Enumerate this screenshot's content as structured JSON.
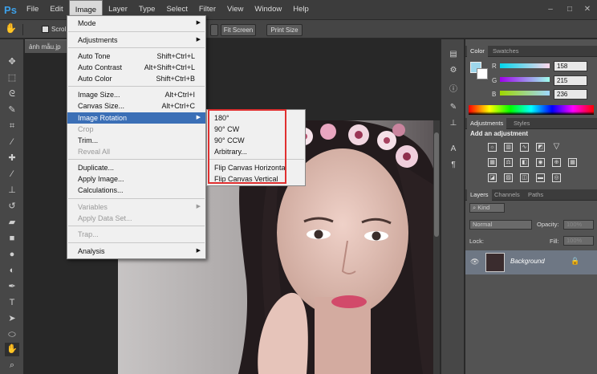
{
  "app": {
    "logo": "Ps"
  },
  "menubar": {
    "items": [
      "File",
      "Edit",
      "Image",
      "Layer",
      "Type",
      "Select",
      "Filter",
      "View",
      "Window",
      "Help"
    ],
    "active": "Image"
  },
  "options": {
    "scroll_label": "Scrol",
    "fit_screen": "Fit Screen",
    "print_size": "Print Size"
  },
  "document": {
    "tab_title": "ảnh mẫu.jp"
  },
  "image_menu": {
    "mode": "Mode",
    "adjustments": "Adjustments",
    "auto_tone": "Auto Tone",
    "auto_tone_sc": "Shift+Ctrl+L",
    "auto_contrast": "Auto Contrast",
    "auto_contrast_sc": "Alt+Shift+Ctrl+L",
    "auto_color": "Auto Color",
    "auto_color_sc": "Shift+Ctrl+B",
    "image_size": "Image Size...",
    "image_size_sc": "Alt+Ctrl+I",
    "canvas_size": "Canvas Size...",
    "canvas_size_sc": "Alt+Ctrl+C",
    "image_rotation": "Image Rotation",
    "crop": "Crop",
    "trim": "Trim...",
    "reveal_all": "Reveal All",
    "duplicate": "Duplicate...",
    "apply_image": "Apply Image...",
    "calculations": "Calculations...",
    "variables": "Variables",
    "apply_data_set": "Apply Data Set...",
    "trap": "Trap...",
    "analysis": "Analysis"
  },
  "rotation_submenu": {
    "r180": "180°",
    "cw90": "90° CW",
    "ccw90": "90° CCW",
    "arbitrary": "Arbitrary...",
    "flip_h": "Flip Canvas Horizontal",
    "flip_v": "Flip Canvas Vertical"
  },
  "color_panel": {
    "tabs": [
      "Color",
      "Swatches"
    ],
    "r_label": "R",
    "g_label": "G",
    "b_label": "B",
    "r": "158",
    "g": "215",
    "b": "236",
    "foreground": "#9ed7ec"
  },
  "adjustments_panel": {
    "tabs": [
      "Adjustments",
      "Styles"
    ],
    "heading": "Add an adjustment"
  },
  "layers_panel": {
    "tabs": [
      "Layers",
      "Channels",
      "Paths"
    ],
    "kind": "Kind",
    "blend_mode": "Normal",
    "opacity_label": "Opacity:",
    "opacity": "100%",
    "lock_label": "Lock:",
    "fill_label": "Fill:",
    "fill": "100%",
    "layer_name": "Background"
  }
}
